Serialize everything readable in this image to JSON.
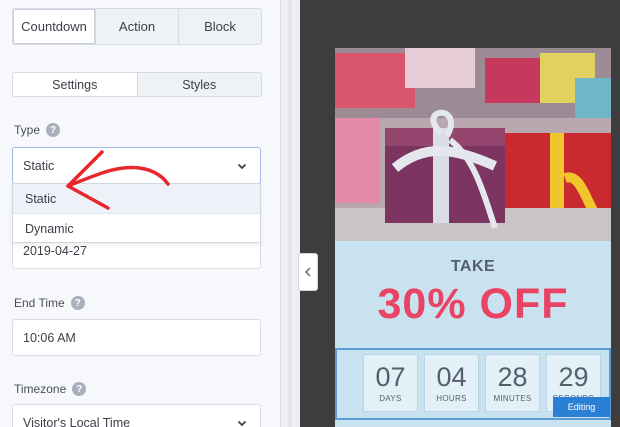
{
  "tabs": [
    {
      "label": "Countdown",
      "active": true
    },
    {
      "label": "Action",
      "active": false
    },
    {
      "label": "Block",
      "active": false
    }
  ],
  "subtabs": [
    {
      "label": "Settings",
      "active": true
    },
    {
      "label": "Styles",
      "active": false
    }
  ],
  "type_field": {
    "label": "Type",
    "value": "Static",
    "options": [
      "Static",
      "Dynamic"
    ]
  },
  "end_date": {
    "value": "2019-04-27"
  },
  "end_time": {
    "label": "End Time",
    "value": "10:06 AM"
  },
  "timezone": {
    "label": "Timezone",
    "value": "Visitor's Local Time"
  },
  "preview": {
    "headline": "TAKE",
    "offer": "30% OFF",
    "countdown": [
      {
        "value": "07",
        "unit": "DAYS"
      },
      {
        "value": "04",
        "unit": "HOURS"
      },
      {
        "value": "28",
        "unit": "MINUTES"
      },
      {
        "value": "29",
        "unit": "SECONDS"
      }
    ],
    "editing_badge": "Editing"
  },
  "colors": {
    "accent": "#e94464",
    "editing": "#2b7fd4",
    "annotation_arrow": "#e8262c"
  }
}
